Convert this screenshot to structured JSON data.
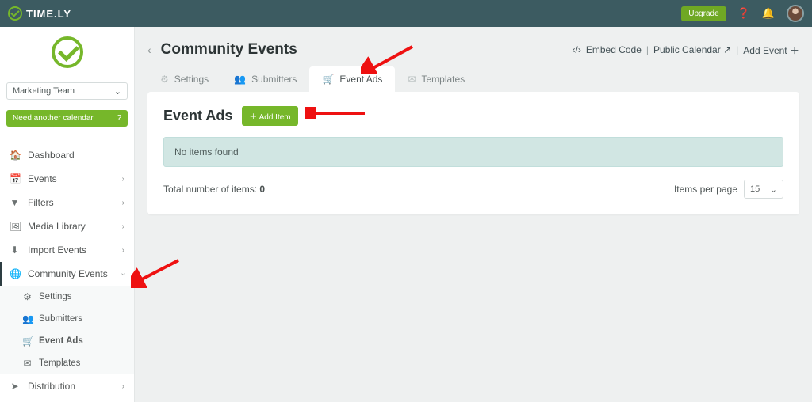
{
  "topbar": {
    "brand": "TIME.LY",
    "upgrade": "Upgrade"
  },
  "sidebar": {
    "team": "Marketing Team",
    "need_calendar": "Need another calendar",
    "items": [
      {
        "label": "Dashboard",
        "icon": "🏠",
        "chev": false
      },
      {
        "label": "Events",
        "icon": "📅",
        "chev": true
      },
      {
        "label": "Filters",
        "icon": "▼",
        "chev": true
      },
      {
        "label": "Media Library",
        "icon": "🖼",
        "chev": true
      },
      {
        "label": "Import Events",
        "icon": "⬇",
        "chev": true
      },
      {
        "label": "Community Events",
        "icon": "🌐",
        "chev": true,
        "expanded": true,
        "active": true
      },
      {
        "label": "Distribution",
        "icon": "➤",
        "chev": true
      }
    ],
    "sub_community": [
      {
        "label": "Settings",
        "icon": "⚙"
      },
      {
        "label": "Submitters",
        "icon": "👥"
      },
      {
        "label": "Event Ads",
        "icon": "🛒",
        "active": true
      },
      {
        "label": "Templates",
        "icon": "✉"
      }
    ]
  },
  "header": {
    "title": "Community Events",
    "actions": {
      "embed": "Embed Code",
      "public": "Public Calendar",
      "add": "Add Event"
    }
  },
  "tabs": [
    {
      "label": "Settings",
      "icon": "⚙"
    },
    {
      "label": "Submitters",
      "icon": "👥"
    },
    {
      "label": "Event Ads",
      "icon": "🛒",
      "active": true
    },
    {
      "label": "Templates",
      "icon": "✉"
    }
  ],
  "card": {
    "title": "Event Ads",
    "add_item": "Add Item",
    "empty": "No items found",
    "total_label": "Total number of items:",
    "total_value": "0",
    "per_page_label": "Items per page",
    "per_page_value": "15"
  }
}
